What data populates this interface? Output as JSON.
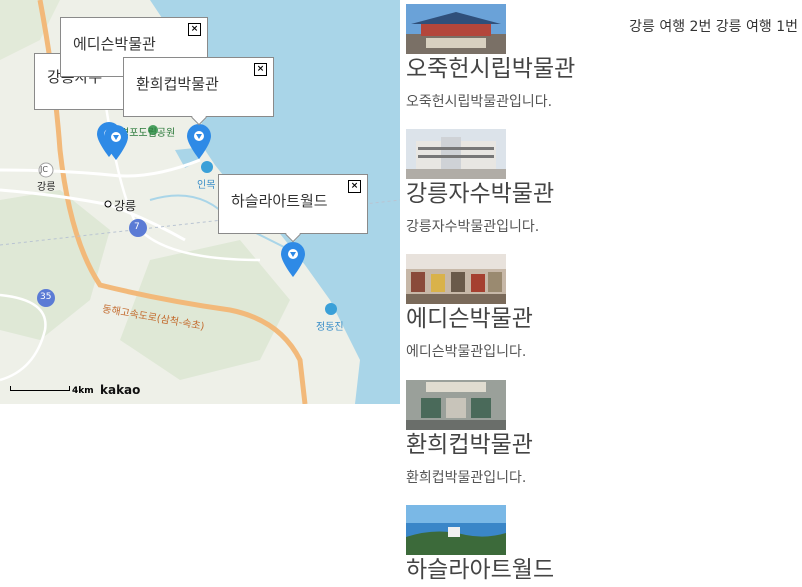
{
  "header": {
    "trips": "강릉 여행 2번 강릉 여행 1번"
  },
  "map": {
    "labels": {
      "gangneung_city": "강릉",
      "gangneung_jc": "강릉",
      "jc": "JC",
      "park": "경포도립공원",
      "inmok": "인목",
      "jeongdongjin": "정동진",
      "route7": "7",
      "route35": "35",
      "expressway": "동해고속도로(삼척-속초)"
    },
    "scale": "4km",
    "logo": "kakao",
    "infowindows": {
      "edison": "에디슨박물관",
      "hanhee": "환희컵박물관",
      "gangneung_partial": "강릉자수",
      "haslla": "하슬라아트월드"
    }
  },
  "places": [
    {
      "name": "오죽헌시립박물관",
      "desc": "오죽헌시립박물관입니다."
    },
    {
      "name": "강릉자수박물관",
      "desc": "강릉자수박물관입니다."
    },
    {
      "name": "에디슨박물관",
      "desc": "에디슨박물관입니다."
    },
    {
      "name": "환희컵박물관",
      "desc": "환희컵박물관입니다."
    },
    {
      "name": "하슬라아트월드",
      "desc": ""
    }
  ],
  "colors": {
    "marker": "#2e8ae6",
    "sea": "#a9d5e8",
    "land": "#eef0e8",
    "highway": "#f2b97a"
  }
}
